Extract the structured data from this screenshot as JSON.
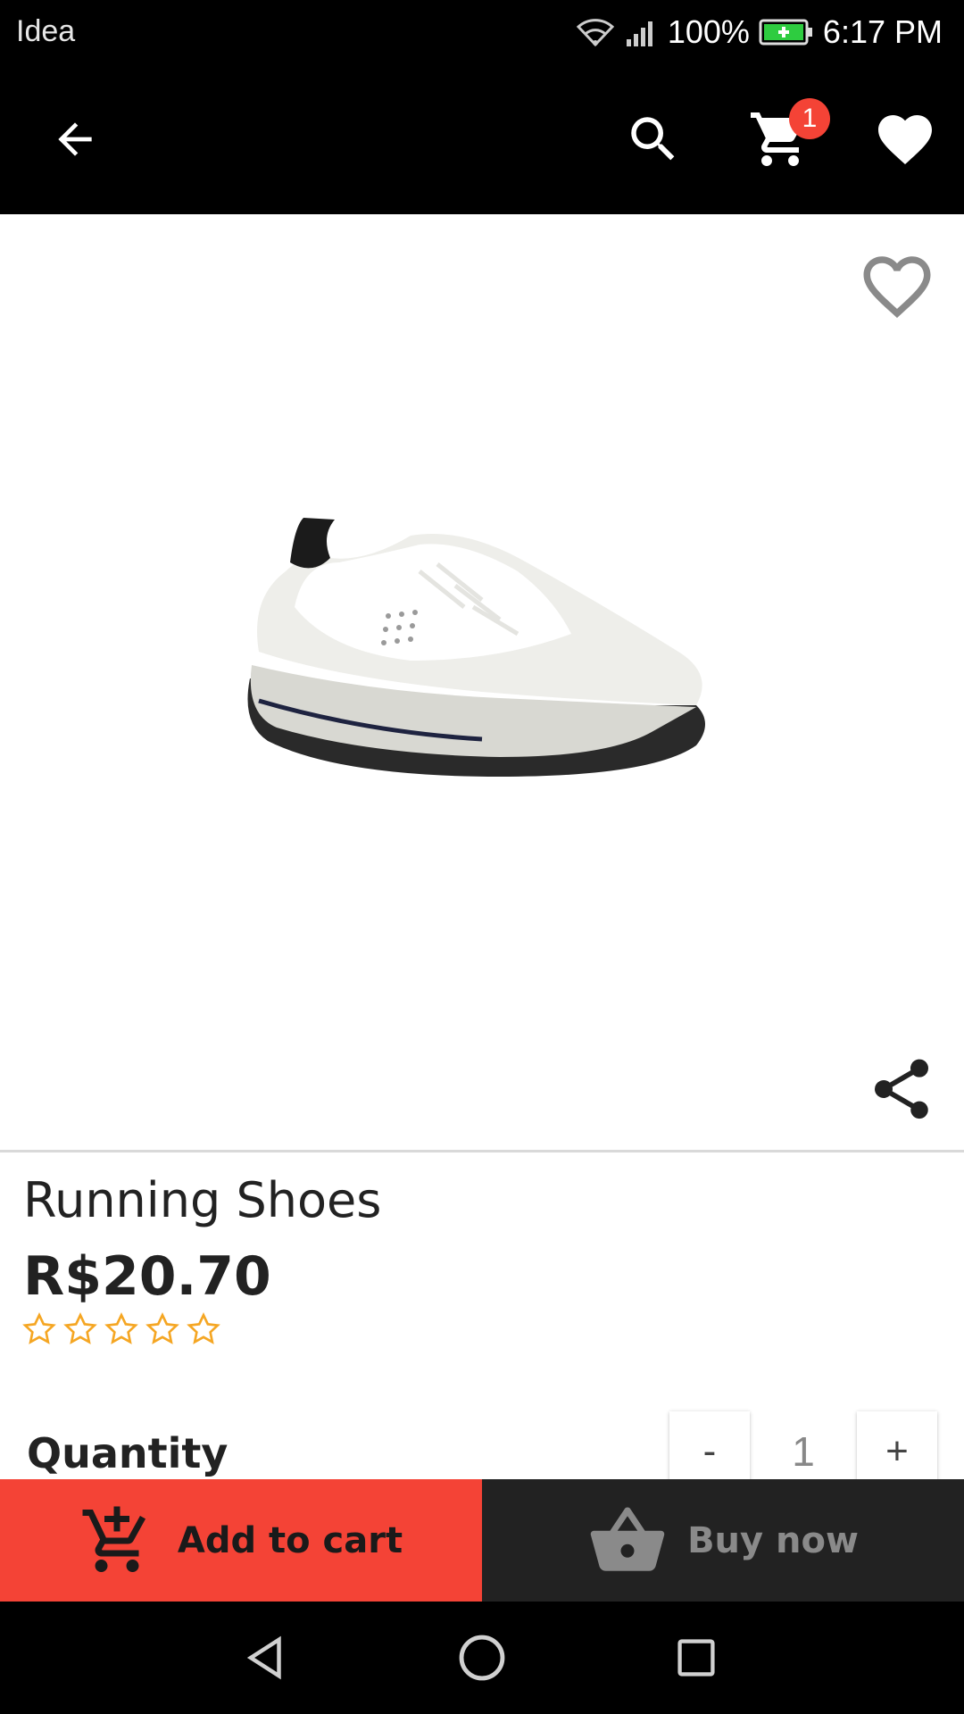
{
  "status_bar": {
    "carrier": "Idea",
    "battery": "100%",
    "time": "6:17 PM"
  },
  "app_bar": {
    "cart_count": "1",
    "icons": [
      "back-arrow-icon",
      "search-icon",
      "cart-icon",
      "heart-icon"
    ]
  },
  "product": {
    "name": "Running Shoes",
    "price": "R$20.70",
    "rating": {
      "value": 0,
      "max": 5
    }
  },
  "quantity": {
    "label": "Quantity",
    "minus": "-",
    "value": "1",
    "plus": "+"
  },
  "actions": {
    "add_to_cart": "Add to cart",
    "buy_now": "Buy now"
  },
  "colors": {
    "accent": "#f44336",
    "star": "#f5a623",
    "dark": "#222222"
  }
}
